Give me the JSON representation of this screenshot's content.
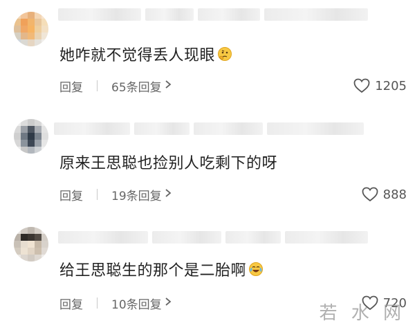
{
  "comments": [
    {
      "text": "她咋就不觉得丢人现眼",
      "emoji": "thinking-face-icon",
      "reply_label": "回复",
      "replies_label": "65条回复",
      "likes": "1205",
      "avatar_colors": [
        "#f3d7b6",
        "#f2c59a",
        "#e8b07a",
        "#f4d6b4",
        "#f7e4cf",
        "#eac28e",
        "#f0a15a",
        "#f2b56c",
        "#e9c79d",
        "#f5deb9",
        "#dec09c",
        "#f0a866",
        "#f7b463",
        "#eecf9f",
        "#f3e0c4",
        "#d6d0c3",
        "#e3b78a",
        "#f1b978",
        "#e9d3b3",
        "#f0e6d7",
        "#cfd6dd",
        "#dbd9d3",
        "#e6d6c2",
        "#e5e2dc",
        "#f1efec"
      ]
    },
    {
      "text": "原来王思聪也捡别人吃剩下的呀",
      "emoji": "",
      "reply_label": "回复",
      "replies_label": "19条回复",
      "likes": "888",
      "avatar_colors": [
        "#eeeeee",
        "#dcdcdc",
        "#cccccc",
        "#d8d8d8",
        "#efefef",
        "#d9d9d9",
        "#9a9fa6",
        "#4e5661",
        "#a9adb3",
        "#e3e3e3",
        "#cfcfcf",
        "#6f7883",
        "#2f3a47",
        "#7b848e",
        "#dedede",
        "#d7d7d7",
        "#8b939c",
        "#3d4754",
        "#9aa1a9",
        "#e6e6e6",
        "#ececec",
        "#c7c7c7",
        "#b2b7bd",
        "#cfd2d5",
        "#f1f1f1"
      ]
    },
    {
      "text": "给王思聪生的那个是二胎啊",
      "emoji": "crying-laughing-icon",
      "reply_label": "回复",
      "replies_label": "10条回复",
      "likes": "720",
      "avatar_colors": [
        "#e9e6e2",
        "#cfc9c2",
        "#bfb8b0",
        "#d6d0c9",
        "#eeebe8",
        "#b9b1a8",
        "#2d2a27",
        "#3a3531",
        "#514a44",
        "#d3cdc6",
        "#c9c1b7",
        "#e7ddd0",
        "#f0e3d2",
        "#c7b9a8",
        "#d8d2cb",
        "#d4ccc1",
        "#ede2d3",
        "#e2d5c5",
        "#cdbfae",
        "#e0dad4",
        "#ebe7e3",
        "#dcd6cf",
        "#d2cbc3",
        "#dfd9d2",
        "#efece9"
      ]
    }
  ],
  "watermark": "若 水 网"
}
